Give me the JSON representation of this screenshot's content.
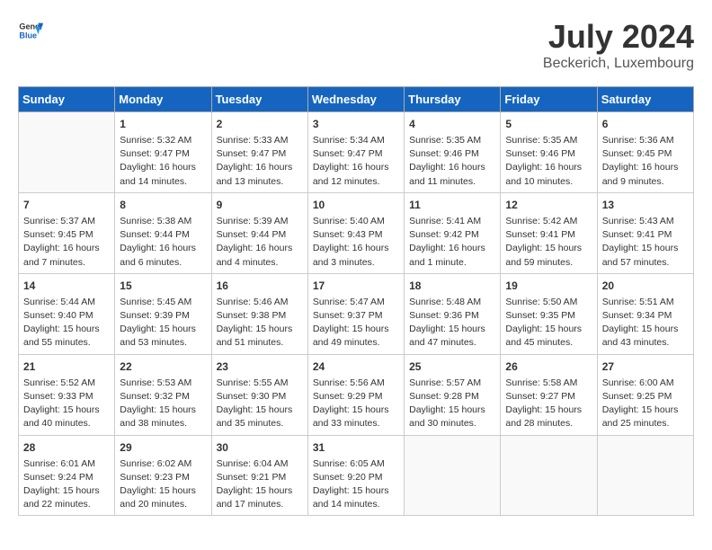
{
  "header": {
    "logo_general": "General",
    "logo_blue": "Blue",
    "month_year": "July 2024",
    "location": "Beckerich, Luxembourg"
  },
  "days_of_week": [
    "Sunday",
    "Monday",
    "Tuesday",
    "Wednesday",
    "Thursday",
    "Friday",
    "Saturday"
  ],
  "weeks": [
    [
      {
        "day": "",
        "info": ""
      },
      {
        "day": "1",
        "info": "Sunrise: 5:32 AM\nSunset: 9:47 PM\nDaylight: 16 hours\nand 14 minutes."
      },
      {
        "day": "2",
        "info": "Sunrise: 5:33 AM\nSunset: 9:47 PM\nDaylight: 16 hours\nand 13 minutes."
      },
      {
        "day": "3",
        "info": "Sunrise: 5:34 AM\nSunset: 9:47 PM\nDaylight: 16 hours\nand 12 minutes."
      },
      {
        "day": "4",
        "info": "Sunrise: 5:35 AM\nSunset: 9:46 PM\nDaylight: 16 hours\nand 11 minutes."
      },
      {
        "day": "5",
        "info": "Sunrise: 5:35 AM\nSunset: 9:46 PM\nDaylight: 16 hours\nand 10 minutes."
      },
      {
        "day": "6",
        "info": "Sunrise: 5:36 AM\nSunset: 9:45 PM\nDaylight: 16 hours\nand 9 minutes."
      }
    ],
    [
      {
        "day": "7",
        "info": "Sunrise: 5:37 AM\nSunset: 9:45 PM\nDaylight: 16 hours\nand 7 minutes."
      },
      {
        "day": "8",
        "info": "Sunrise: 5:38 AM\nSunset: 9:44 PM\nDaylight: 16 hours\nand 6 minutes."
      },
      {
        "day": "9",
        "info": "Sunrise: 5:39 AM\nSunset: 9:44 PM\nDaylight: 16 hours\nand 4 minutes."
      },
      {
        "day": "10",
        "info": "Sunrise: 5:40 AM\nSunset: 9:43 PM\nDaylight: 16 hours\nand 3 minutes."
      },
      {
        "day": "11",
        "info": "Sunrise: 5:41 AM\nSunset: 9:42 PM\nDaylight: 16 hours\nand 1 minute."
      },
      {
        "day": "12",
        "info": "Sunrise: 5:42 AM\nSunset: 9:41 PM\nDaylight: 15 hours\nand 59 minutes."
      },
      {
        "day": "13",
        "info": "Sunrise: 5:43 AM\nSunset: 9:41 PM\nDaylight: 15 hours\nand 57 minutes."
      }
    ],
    [
      {
        "day": "14",
        "info": "Sunrise: 5:44 AM\nSunset: 9:40 PM\nDaylight: 15 hours\nand 55 minutes."
      },
      {
        "day": "15",
        "info": "Sunrise: 5:45 AM\nSunset: 9:39 PM\nDaylight: 15 hours\nand 53 minutes."
      },
      {
        "day": "16",
        "info": "Sunrise: 5:46 AM\nSunset: 9:38 PM\nDaylight: 15 hours\nand 51 minutes."
      },
      {
        "day": "17",
        "info": "Sunrise: 5:47 AM\nSunset: 9:37 PM\nDaylight: 15 hours\nand 49 minutes."
      },
      {
        "day": "18",
        "info": "Sunrise: 5:48 AM\nSunset: 9:36 PM\nDaylight: 15 hours\nand 47 minutes."
      },
      {
        "day": "19",
        "info": "Sunrise: 5:50 AM\nSunset: 9:35 PM\nDaylight: 15 hours\nand 45 minutes."
      },
      {
        "day": "20",
        "info": "Sunrise: 5:51 AM\nSunset: 9:34 PM\nDaylight: 15 hours\nand 43 minutes."
      }
    ],
    [
      {
        "day": "21",
        "info": "Sunrise: 5:52 AM\nSunset: 9:33 PM\nDaylight: 15 hours\nand 40 minutes."
      },
      {
        "day": "22",
        "info": "Sunrise: 5:53 AM\nSunset: 9:32 PM\nDaylight: 15 hours\nand 38 minutes."
      },
      {
        "day": "23",
        "info": "Sunrise: 5:55 AM\nSunset: 9:30 PM\nDaylight: 15 hours\nand 35 minutes."
      },
      {
        "day": "24",
        "info": "Sunrise: 5:56 AM\nSunset: 9:29 PM\nDaylight: 15 hours\nand 33 minutes."
      },
      {
        "day": "25",
        "info": "Sunrise: 5:57 AM\nSunset: 9:28 PM\nDaylight: 15 hours\nand 30 minutes."
      },
      {
        "day": "26",
        "info": "Sunrise: 5:58 AM\nSunset: 9:27 PM\nDaylight: 15 hours\nand 28 minutes."
      },
      {
        "day": "27",
        "info": "Sunrise: 6:00 AM\nSunset: 9:25 PM\nDaylight: 15 hours\nand 25 minutes."
      }
    ],
    [
      {
        "day": "28",
        "info": "Sunrise: 6:01 AM\nSunset: 9:24 PM\nDaylight: 15 hours\nand 22 minutes."
      },
      {
        "day": "29",
        "info": "Sunrise: 6:02 AM\nSunset: 9:23 PM\nDaylight: 15 hours\nand 20 minutes."
      },
      {
        "day": "30",
        "info": "Sunrise: 6:04 AM\nSunset: 9:21 PM\nDaylight: 15 hours\nand 17 minutes."
      },
      {
        "day": "31",
        "info": "Sunrise: 6:05 AM\nSunset: 9:20 PM\nDaylight: 15 hours\nand 14 minutes."
      },
      {
        "day": "",
        "info": ""
      },
      {
        "day": "",
        "info": ""
      },
      {
        "day": "",
        "info": ""
      }
    ]
  ]
}
